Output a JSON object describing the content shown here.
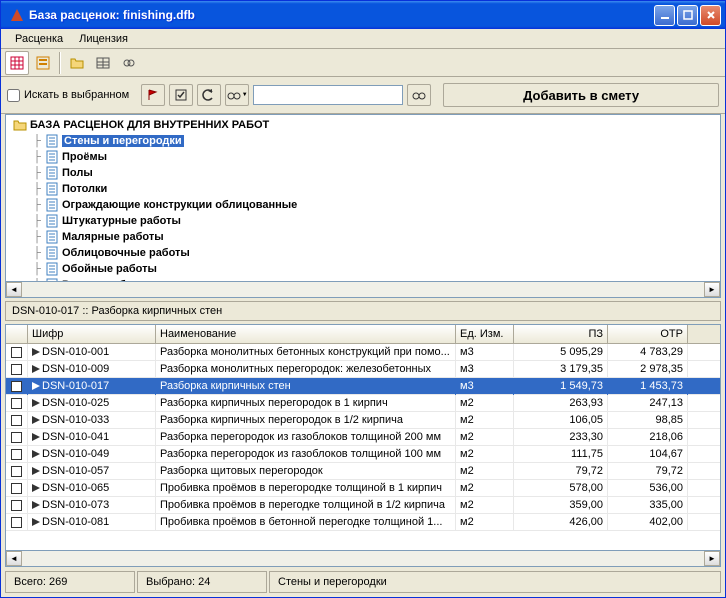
{
  "window": {
    "title": "База расценок:   finishing.dfb"
  },
  "menu": {
    "rate": "Расценка",
    "license": "Лицензия"
  },
  "search": {
    "in_selection": "Искать в выбранном",
    "placeholder": "",
    "add_button": "Добавить в смету"
  },
  "tree": {
    "root": "БАЗА РАСЦЕНОК ДЛЯ ВНУТРЕННИХ РАБОТ",
    "items": [
      "Стены и перегородки",
      "Проёмы",
      "Полы",
      "Потолки",
      "Ограждающие конструкции облицованные",
      "Штукатурные работы",
      "Малярные работы",
      "Облицовочные работы",
      "Обойные работы",
      "Разные работы"
    ]
  },
  "detail": "DSN-010-017 :: Разборка кирпичных стен",
  "grid": {
    "headers": {
      "code": "Шифр",
      "name": "Наименование",
      "unit": "Ед. Изм.",
      "pz": "ПЗ",
      "otr": "ОТР"
    },
    "rows": [
      {
        "code": "DSN-010-001",
        "name": "Разборка монолитных бетонных конструкций при помо...",
        "unit": "м3",
        "pz": "5 095,29",
        "otr": "4 783,29",
        "sel": false
      },
      {
        "code": "DSN-010-009",
        "name": "Разборка монолитных перегородок: железобетонных",
        "unit": "м3",
        "pz": "3 179,35",
        "otr": "2 978,35",
        "sel": false
      },
      {
        "code": "DSN-010-017",
        "name": "Разборка кирпичных стен",
        "unit": "м3",
        "pz": "1 549,73",
        "otr": "1 453,73",
        "sel": true
      },
      {
        "code": "DSN-010-025",
        "name": "Разборка кирпичных перегородок в 1 кирпич",
        "unit": "м2",
        "pz": "263,93",
        "otr": "247,13",
        "sel": false
      },
      {
        "code": "DSN-010-033",
        "name": "Разборка кирпичных перегородок в 1/2 кирпича",
        "unit": "м2",
        "pz": "106,05",
        "otr": "98,85",
        "sel": false
      },
      {
        "code": "DSN-010-041",
        "name": "Разборка перегородок из газоблоков  толщиной 200 мм",
        "unit": "м2",
        "pz": "233,30",
        "otr": "218,06",
        "sel": false
      },
      {
        "code": "DSN-010-049",
        "name": "Разборка перегородок из газоблоков  толщиной 100 мм",
        "unit": "м2",
        "pz": "111,75",
        "otr": "104,67",
        "sel": false
      },
      {
        "code": "DSN-010-057",
        "name": "Разборка щитовых перегородок",
        "unit": "м2",
        "pz": "79,72",
        "otr": "79,72",
        "sel": false
      },
      {
        "code": "DSN-010-065",
        "name": "Пробивка проёмов в перегородке толщиной в 1 кирпич",
        "unit": "м2",
        "pz": "578,00",
        "otr": "536,00",
        "sel": false
      },
      {
        "code": "DSN-010-073",
        "name": "Пробивка проёмов в перегодке толщиной в 1/2 кирпича",
        "unit": "м2",
        "pz": "359,00",
        "otr": "335,00",
        "sel": false
      },
      {
        "code": "DSN-010-081",
        "name": "Пробивка проёмов в бетонной перегодке толщиной 1...",
        "unit": "м2",
        "pz": "426,00",
        "otr": "402,00",
        "sel": false
      }
    ]
  },
  "status": {
    "total": "Всего: 269",
    "selected": "Выбрано: 24",
    "section": "Стены и перегородки"
  }
}
